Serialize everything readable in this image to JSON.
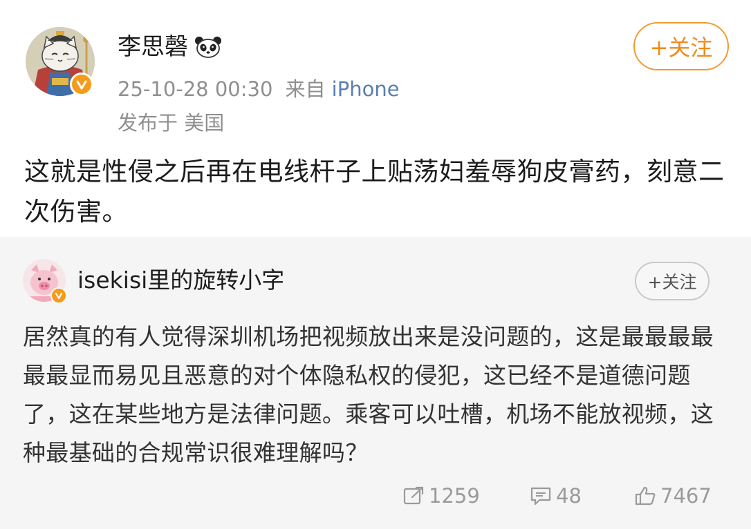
{
  "post": {
    "author": "李思磬",
    "timestamp": "25-10-28 00:30",
    "source_prefix": "来自",
    "source": "iPhone",
    "location": "发布于 美国",
    "follow_label": "+关注",
    "text": "这就是性侵之后再在电线杆子上贴荡妇羞辱狗皮膏药，刻意二次伤害。"
  },
  "repost": {
    "author": "isekisi里的旋转小字",
    "follow_label": "+关注",
    "text": "居然真的有人觉得深圳机场把视频放出来是没问题的，这是最最最最最最显而易见且恶意的对个体隐私权的侵犯，这已经不是道德问题了，这在某些地方是法律问题。乘客可以吐槽，机场不能放视频，这种最基础的合规常识很难理解吗？",
    "actions": {
      "reposts": "1259",
      "comments": "48",
      "likes": "7467"
    }
  },
  "colors": {
    "follow_accent": "#f08a1c",
    "verified_badge": "#f59b1b",
    "source_link": "#5a7fb0",
    "repost_background": "#f5f5f5"
  }
}
